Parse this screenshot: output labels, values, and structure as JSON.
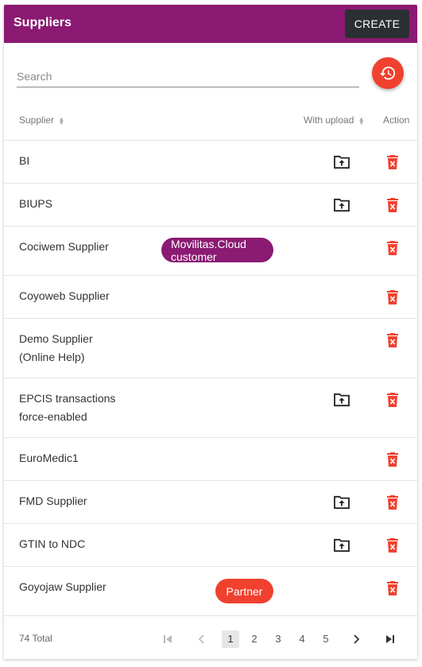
{
  "header": {
    "title": "Suppliers",
    "create_label": "CREATE"
  },
  "search": {
    "placeholder": "Search",
    "value": ""
  },
  "columns": {
    "supplier": "Supplier",
    "with_upload": "With upload",
    "action": "Action"
  },
  "rows": [
    {
      "name_line1": "BI",
      "name_line2": "",
      "has_upload": true
    },
    {
      "name_line1": "BIUPS",
      "name_line2": "",
      "has_upload": true
    },
    {
      "name_line1": "Cociwem Supplier",
      "name_line2": "",
      "has_upload": false,
      "badge": "Movilitas.Cloud customer"
    },
    {
      "name_line1": "Coyoweb Supplier",
      "name_line2": "",
      "has_upload": false
    },
    {
      "name_line1": "Demo Supplier",
      "name_line2": "(Online Help)",
      "has_upload": false
    },
    {
      "name_line1": "EPCIS transactions",
      "name_line2": "force-enabled",
      "has_upload": true
    },
    {
      "name_line1": "EuroMedic1",
      "name_line2": "",
      "has_upload": false
    },
    {
      "name_line1": "FMD Supplier",
      "name_line2": "",
      "has_upload": true
    },
    {
      "name_line1": "GTIN to NDC",
      "name_line2": "",
      "has_upload": true
    },
    {
      "name_line1": "Goyojaw Supplier",
      "name_line2": "",
      "has_upload": false,
      "badge": "Partner"
    }
  ],
  "badges": {
    "cloud_line1": "Movilitas.Cloud",
    "cloud_line2": "customer",
    "partner": "Partner"
  },
  "footer": {
    "total": "74 Total",
    "pages": [
      "1",
      "2",
      "3",
      "4",
      "5"
    ],
    "current_page": "1"
  },
  "colors": {
    "brand": "#8b1a72",
    "accent": "#f0412f",
    "dark_button": "#2b2f33"
  }
}
